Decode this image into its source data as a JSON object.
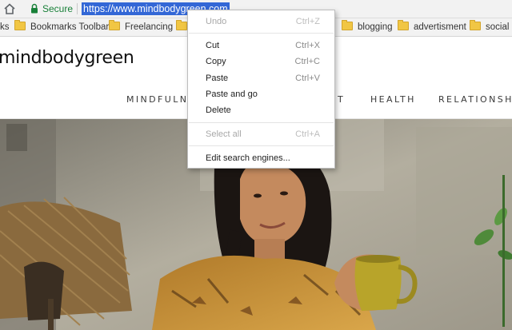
{
  "address_bar": {
    "home_icon": "home-icon",
    "lock_icon": "lock-icon",
    "secure_label": "Secure",
    "url": "https://www.mindbodygreen.com",
    "secure_color": "#188038",
    "selection_color": "#3367d6"
  },
  "bookmarks_bar": {
    "items": [
      {
        "label": "ks",
        "folder": false
      },
      {
        "label": "Bookmarks Toolbar",
        "folder": true
      },
      {
        "label": "Freelancing",
        "folder": true
      },
      {
        "label": "",
        "folder": true
      },
      {
        "label": "blogging",
        "folder": true
      },
      {
        "label": "advertisment",
        "folder": true
      },
      {
        "label": "social",
        "folder": true
      }
    ]
  },
  "site": {
    "logo": "mindbodygreen",
    "nav": [
      "MINDFULNE",
      "T",
      "HEALTH",
      "RELATIONSHIP"
    ]
  },
  "context_menu": {
    "items": [
      {
        "label": "Undo",
        "shortcut": "Ctrl+Z",
        "enabled": false
      },
      {
        "label": "Cut",
        "shortcut": "Ctrl+X",
        "enabled": true
      },
      {
        "label": "Copy",
        "shortcut": "Ctrl+C",
        "enabled": true
      },
      {
        "label": "Paste",
        "shortcut": "Ctrl+V",
        "enabled": true
      },
      {
        "label": "Paste and go",
        "shortcut": "",
        "enabled": true
      },
      {
        "label": "Delete",
        "shortcut": "",
        "enabled": true
      },
      {
        "label": "Select all",
        "shortcut": "Ctrl+A",
        "enabled": false
      },
      {
        "label": "Edit search engines...",
        "shortcut": "",
        "enabled": true
      }
    ]
  }
}
